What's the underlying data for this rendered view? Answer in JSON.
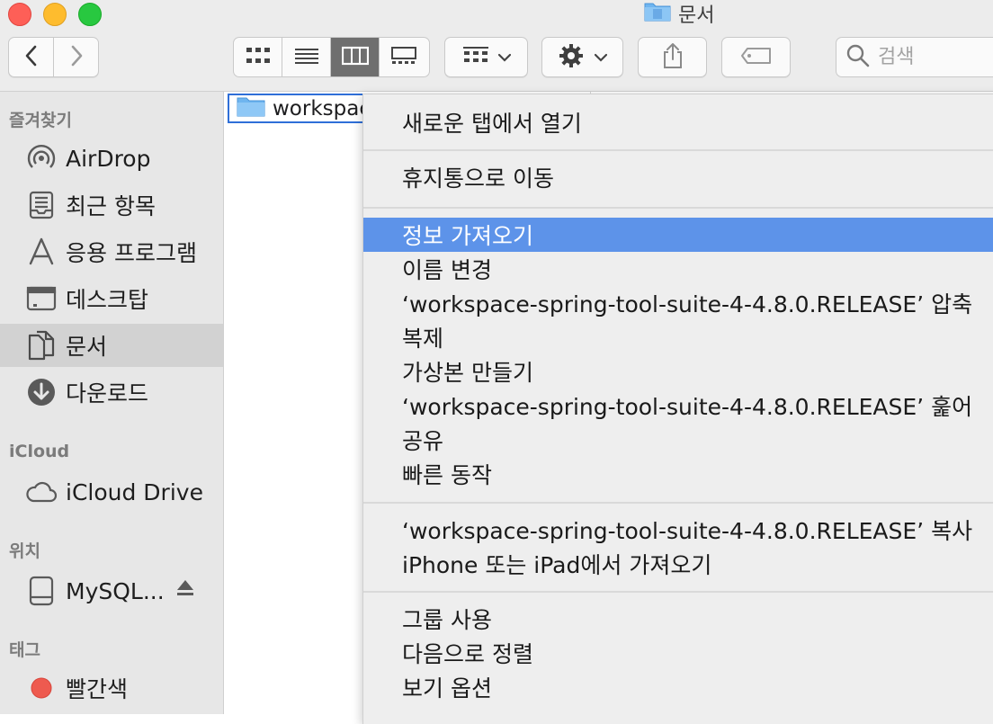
{
  "window": {
    "title": "문서"
  },
  "toolbar": {
    "back_icon": "chevron-left-icon",
    "forward_icon": "chevron-right-icon",
    "view_modes": [
      "icon-view",
      "list-view",
      "column-view",
      "gallery-view"
    ],
    "active_view": "column-view",
    "group_icon": "group-grid-icon",
    "action_icon": "gear-icon",
    "share_icon": "share-icon",
    "tag_icon": "tag-icon",
    "search_placeholder": "검색"
  },
  "sidebar": {
    "favorites_label": "즐겨찾기",
    "favorites": [
      {
        "label": "AirDrop",
        "icon": "airdrop-icon"
      },
      {
        "label": "최근 항목",
        "icon": "recents-icon"
      },
      {
        "label": "응용 프로그램",
        "icon": "applications-icon"
      },
      {
        "label": "데스크탑",
        "icon": "desktop-icon"
      },
      {
        "label": "문서",
        "icon": "documents-icon",
        "selected": true
      },
      {
        "label": "다운로드",
        "icon": "downloads-icon"
      }
    ],
    "icloud_label": "iCloud",
    "icloud": [
      {
        "label": "iCloud Drive",
        "icon": "cloud-icon"
      }
    ],
    "locations_label": "위치",
    "locations": [
      {
        "label": "MySQL...",
        "icon": "drive-icon"
      }
    ],
    "tags_label": "태그",
    "tags": [
      {
        "label": "빨간색",
        "color": "#ee5a4f"
      }
    ]
  },
  "files": [
    {
      "name": "workspace-spring-tool-suite-4-4.8.0.RELEASE",
      "visible_name": "workspac",
      "icon": "folder-icon",
      "selected": true
    }
  ],
  "context_menu": {
    "groups": [
      [
        "새로운 탭에서 열기"
      ],
      [
        "휴지통으로 이동"
      ],
      [
        "정보 가져오기",
        "이름 변경",
        "‘workspace-spring-tool-suite-4-4.8.0.RELEASE’ 압축",
        "복제",
        "가상본 만들기",
        "‘workspace-spring-tool-suite-4-4.8.0.RELEASE’ 훑어",
        "공유",
        "빠른 동작"
      ],
      [
        "‘workspace-spring-tool-suite-4-4.8.0.RELEASE’ 복사",
        "iPhone 또는 iPad에서 가져오기"
      ],
      [
        "그룹 사용",
        "다음으로 정렬",
        "보기 옵션"
      ]
    ],
    "highlighted": "정보 가져오기",
    "highlight_color": "#5d93e9"
  }
}
